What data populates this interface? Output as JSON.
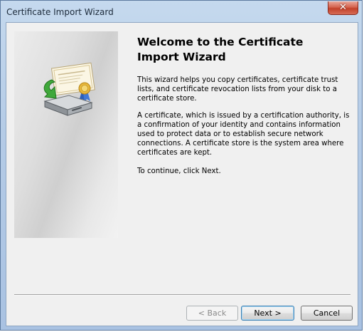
{
  "window": {
    "title": "Certificate Import Wizard"
  },
  "wizard": {
    "heading": "Welcome to the Certificate Import Wizard",
    "paragraphs": [
      "This wizard helps you copy certificates, certificate trust lists, and certificate revocation lists from your disk to a certificate store.",
      "A certificate, which is issued by a certification authority, is a confirmation of your identity and contains information used to protect data or to establish secure network connections. A certificate store is the system area where certificates are kept.",
      "To continue, click Next."
    ]
  },
  "buttons": {
    "back": "< Back",
    "next": "Next >",
    "cancel": "Cancel"
  },
  "icons": {
    "close": "close-icon",
    "illustration": "certificate-import-icon"
  },
  "colors": {
    "title_bar": "#b4cbe6",
    "close_button": "#c2412a",
    "client_background": "#f0f0f0"
  }
}
